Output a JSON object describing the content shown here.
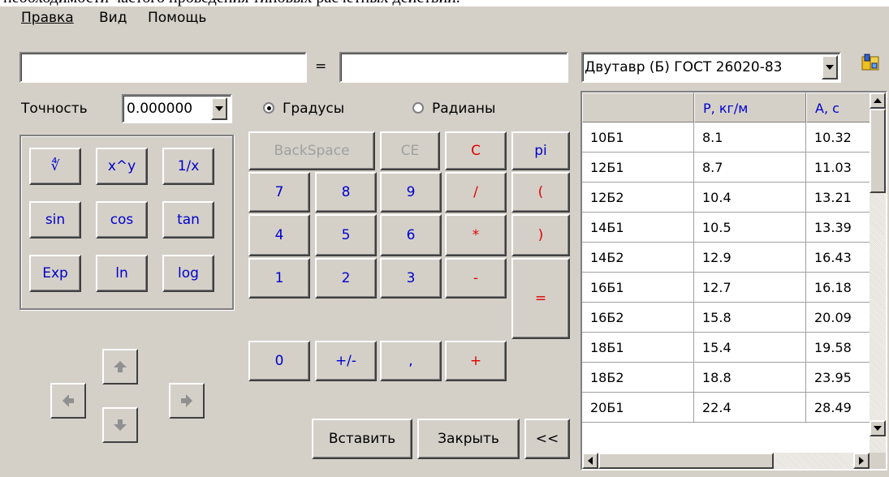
{
  "caption": "необходимости частого проведения типовых расчетных действий.",
  "menu": {
    "edit": "Правка",
    "view": "Вид",
    "help": "Помощь"
  },
  "expression": {
    "value": "",
    "equals": "=",
    "result": ""
  },
  "profile_select": {
    "value": "Двутавр (Б) ГОСТ 26020-83"
  },
  "precision": {
    "label": "Точность",
    "value": "0.000000"
  },
  "angle_mode": {
    "degrees": "Градусы",
    "radians": "Радианы",
    "selected": "degrees"
  },
  "func_keys": [
    "∜",
    "x^y",
    "1/x",
    "sin",
    "cos",
    "tan",
    "Exp",
    "ln",
    "log"
  ],
  "keypad": {
    "backspace": "BackSpace",
    "ce": "CE",
    "c": "C",
    "pi": "pi",
    "k7": "7",
    "k8": "8",
    "k9": "9",
    "div": "/",
    "lparen": "(",
    "k4": "4",
    "k5": "5",
    "k6": "6",
    "mul": "*",
    "rparen": ")",
    "k1": "1",
    "k2": "2",
    "k3": "3",
    "minus": "-",
    "eq": "=",
    "k0": "0",
    "sign": "+/-",
    "dot": ",",
    "plus": "+"
  },
  "actions": {
    "insert": "Вставить",
    "close": "Закрыть",
    "collapse": "<<"
  },
  "table": {
    "headers": [
      "",
      "P, кг/м",
      "A, с"
    ],
    "rows": [
      [
        "10Б1",
        "8.1",
        "10.32"
      ],
      [
        "12Б1",
        "8.7",
        "11.03"
      ],
      [
        "12Б2",
        "10.4",
        "13.21"
      ],
      [
        "14Б1",
        "10.5",
        "13.39"
      ],
      [
        "14Б2",
        "12.9",
        "16.43"
      ],
      [
        "16Б1",
        "12.7",
        "16.18"
      ],
      [
        "16Б2",
        "15.8",
        "20.09"
      ],
      [
        "18Б1",
        "15.4",
        "19.58"
      ],
      [
        "18Б2",
        "18.8",
        "23.95"
      ],
      [
        "20Б1",
        "22.4",
        "28.49"
      ]
    ]
  },
  "colors": {
    "face": "#d4d0c8",
    "operator": "#e00000",
    "digit": "#0000cc",
    "disabled": "#a0a0a0"
  }
}
